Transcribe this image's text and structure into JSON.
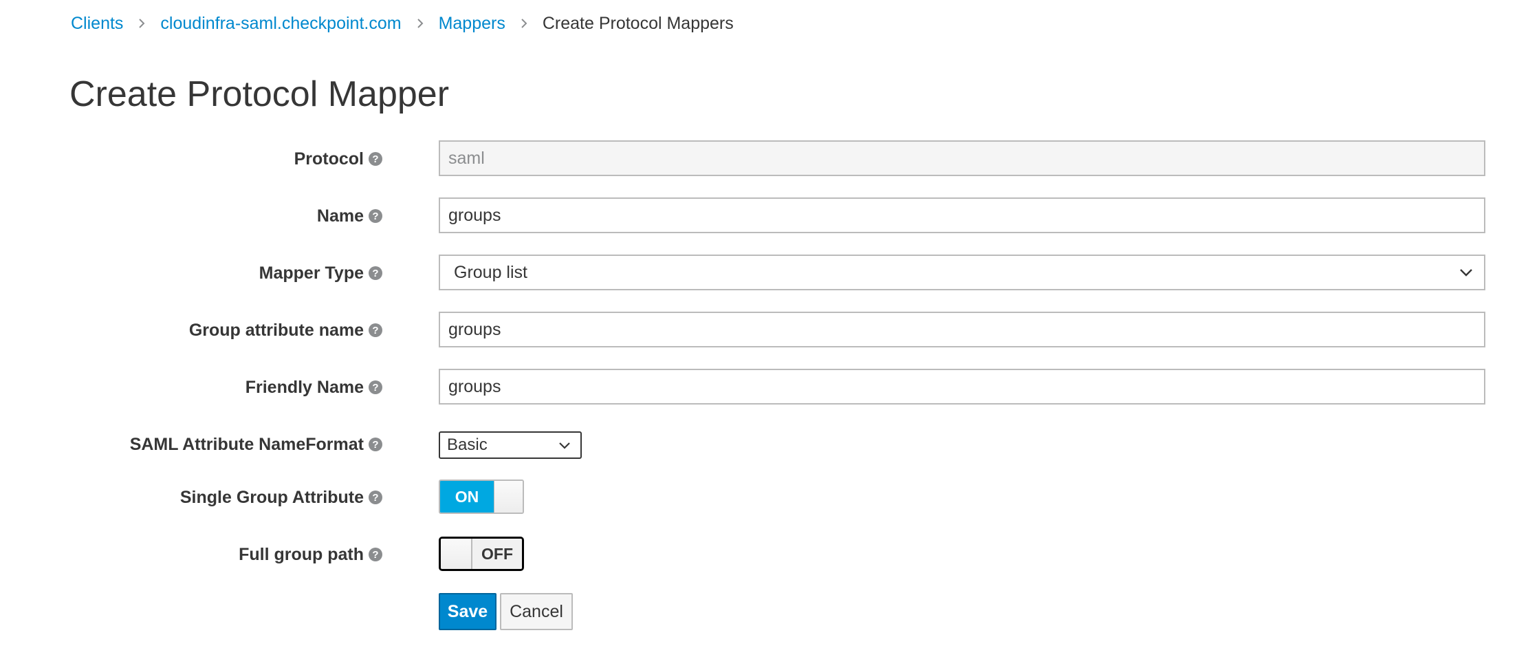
{
  "breadcrumb": {
    "items": [
      {
        "label": "Clients"
      },
      {
        "label": "cloudinfra-saml.checkpoint.com"
      },
      {
        "label": "Mappers"
      }
    ],
    "current": "Create Protocol Mappers"
  },
  "page": {
    "title": "Create Protocol Mapper"
  },
  "form": {
    "protocol": {
      "label": "Protocol",
      "value": "saml"
    },
    "name": {
      "label": "Name",
      "value": "groups"
    },
    "mapper_type": {
      "label": "Mapper Type",
      "value": "Group list"
    },
    "group_attribute_name": {
      "label": "Group attribute name",
      "value": "groups"
    },
    "friendly_name": {
      "label": "Friendly Name",
      "value": "groups"
    },
    "saml_nameformat": {
      "label": "SAML Attribute NameFormat",
      "value": "Basic"
    },
    "single_group_attribute": {
      "label": "Single Group Attribute",
      "state": "ON"
    },
    "full_group_path": {
      "label": "Full group path",
      "state": "OFF"
    }
  },
  "buttons": {
    "save": "Save",
    "cancel": "Cancel"
  },
  "icons": {
    "help": "question-circle-icon",
    "chevron": "chevron-down-icon",
    "separator": "chevron-right-icon"
  },
  "colors": {
    "link": "#0088ce",
    "toggle_on": "#00a8e1",
    "primary_button": "#0088ce",
    "text": "#363636",
    "readonly_bg": "#f5f5f5"
  }
}
